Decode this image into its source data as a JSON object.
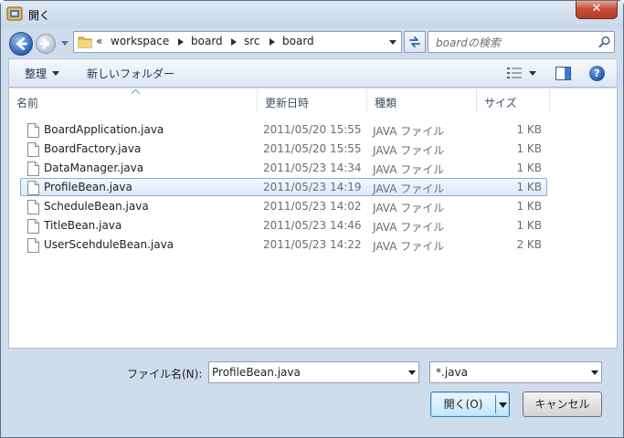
{
  "window": {
    "title": "開く",
    "close_label": "✕"
  },
  "nav": {
    "breadcrumb_overflow": "«",
    "breadcrumb": [
      "workspace",
      "board",
      "src",
      "board"
    ],
    "search_placeholder": "boardの検索"
  },
  "toolbar": {
    "organize_label": "整理",
    "new_folder_label": "新しいフォルダー",
    "help_label": "?"
  },
  "columns": {
    "name": "名前",
    "date": "更新日時",
    "type": "種類",
    "size": "サイズ"
  },
  "files": [
    {
      "name": "BoardApplication.java",
      "date": "2011/05/20 15:55",
      "type": "JAVA ファイル",
      "size": "1 KB"
    },
    {
      "name": "BoardFactory.java",
      "date": "2011/05/20 15:55",
      "type": "JAVA ファイル",
      "size": "1 KB"
    },
    {
      "name": "DataManager.java",
      "date": "2011/05/23 14:34",
      "type": "JAVA ファイル",
      "size": "1 KB"
    },
    {
      "name": "ProfileBean.java",
      "date": "2011/05/23 14:19",
      "type": "JAVA ファイル",
      "size": "1 KB"
    },
    {
      "name": "ScheduleBean.java",
      "date": "2011/05/23 14:02",
      "type": "JAVA ファイル",
      "size": "1 KB"
    },
    {
      "name": "TitleBean.java",
      "date": "2011/05/23 14:46",
      "type": "JAVA ファイル",
      "size": "1 KB"
    },
    {
      "name": "UserScehduleBean.java",
      "date": "2011/05/23 14:22",
      "type": "JAVA ファイル",
      "size": "2 KB"
    }
  ],
  "selected_file": "ProfileBean.java",
  "footer": {
    "filename_label": "ファイル名(N):",
    "filename_value": "ProfileBean.java",
    "filter_value": "*.java",
    "open_label": "開く(O)",
    "cancel_label": "キャンセル"
  },
  "colors": {
    "selection_border": "#84acdd",
    "accent": "#2b62b6"
  }
}
